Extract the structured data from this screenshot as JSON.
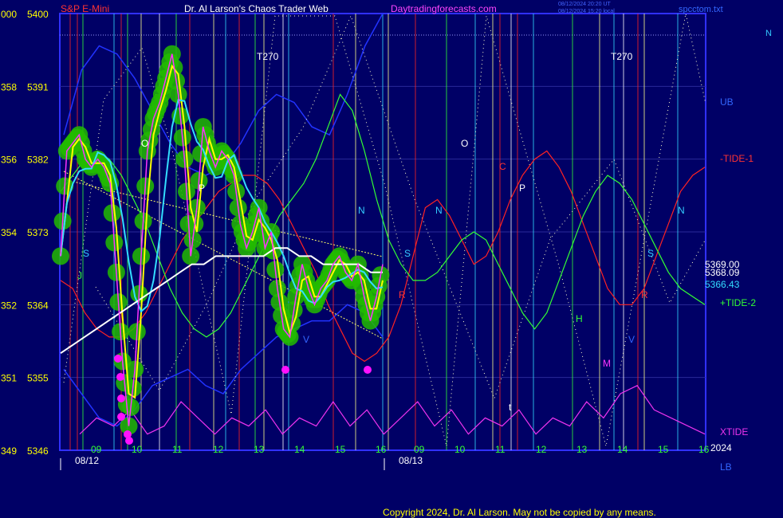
{
  "header": {
    "instrument": "S&P E-Mini",
    "title": "Dr. Al Larson's Chaos Trader Web",
    "site": "Daytradingforecasts.com",
    "stamp1": "08/12/2024 20:20 UT",
    "stamp2": "08/12/2024 15:20 local",
    "file": "spcctom.txt",
    "corner": "N"
  },
  "footer": {
    "copyright": "Copyright 2024, Dr. Al Larson. May not be copied by any means.",
    "year": "2024"
  },
  "chart_data": {
    "type": "line",
    "ylim": [
      5346,
      5400
    ],
    "y_ticks_price": [
      "5400",
      "5391",
      "5382",
      "5373",
      "5364",
      "5355",
      "5346"
    ],
    "y_ticks_left": [
      "000",
      "358",
      "356",
      "354",
      "352",
      "351",
      "349"
    ],
    "x_hours_day1": [
      "09",
      "10",
      "11",
      "12",
      "13",
      "14",
      "15",
      "16"
    ],
    "x_hours_day2": [
      "09",
      "10",
      "11",
      "12",
      "13",
      "14",
      "15",
      "16"
    ],
    "dates": [
      "08/12",
      "08/13"
    ],
    "price_labels": {
      "close": "5369.00",
      "mid": "5368.09",
      "avg": "5366.43"
    },
    "right_labels": {
      "ub": "UB",
      "tide1": "-TIDE-1",
      "tide2": "+TIDE-2",
      "xtide": "XTIDE",
      "lb": "LB"
    },
    "markers": {
      "t270": "T270",
      "n": "N",
      "s": "S",
      "o": "O",
      "p": "P",
      "c": "C",
      "h": "H",
      "m": "M",
      "t": "t",
      "v": "V",
      "j": "J",
      "r": "R"
    },
    "colors": {
      "background": "#000066",
      "frame": "#3030ff",
      "price": "#ff33ff",
      "price_band": "#22bb00",
      "fast_avg": "#ffff00",
      "mid_avg": "#33ddff",
      "slow_avg": "#ffffff",
      "tide1": "#ff2222",
      "tide2": "#33ff33",
      "xtide": "#ee33ee",
      "bands": "#2233ff",
      "dots": "#ffffcc"
    },
    "series": [
      {
        "name": "Price",
        "values": [
          5370,
          5383,
          5384,
          5385,
          5382,
          5381,
          5382,
          5381,
          5379,
          5368,
          5357,
          5349,
          5356,
          5370,
          5383,
          5387,
          5389,
          5392,
          5395,
          5390,
          5382,
          5370,
          5376,
          5386,
          5383,
          5381,
          5383,
          5382,
          5380,
          5374,
          5371,
          5373,
          5376,
          5371,
          5373,
          5366,
          5361,
          5360,
          5365,
          5369,
          5366,
          5364,
          5366,
          5367,
          5369,
          5370,
          5368,
          5367,
          5369,
          5365,
          5362,
          5365,
          5369
        ]
      },
      {
        "name": "-TIDE-1",
        "values": [
          5367,
          5366,
          5363,
          5361,
          5360,
          5360,
          5361,
          5363,
          5366,
          5369,
          5372,
          5374,
          5376,
          5378,
          5379,
          5380,
          5380,
          5379,
          5377,
          5374,
          5371,
          5368,
          5364,
          5361,
          5358,
          5357,
          5358,
          5360,
          5364,
          5370,
          5376,
          5377,
          5375,
          5372,
          5369,
          5370,
          5373,
          5377,
          5380,
          5382,
          5383,
          5381,
          5378,
          5374,
          5370,
          5366,
          5364,
          5364,
          5366,
          5370,
          5374,
          5378,
          5380,
          5381
        ]
      },
      {
        "name": "+TIDE-2",
        "values": [
          5378,
          5380,
          5382,
          5383,
          5382,
          5380,
          5377,
          5374,
          5370,
          5366,
          5363,
          5361,
          5360,
          5361,
          5363,
          5366,
          5369,
          5372,
          5375,
          5377,
          5379,
          5382,
          5386,
          5390,
          5388,
          5383,
          5377,
          5372,
          5369,
          5367,
          5367,
          5368,
          5370,
          5372,
          5373,
          5372,
          5369,
          5366,
          5363,
          5361,
          5363,
          5367,
          5371,
          5375,
          5378,
          5380,
          5379,
          5377,
          5374,
          5371,
          5368,
          5366,
          5365,
          5364
        ]
      },
      {
        "name": "XTIDE",
        "values": [
          5348,
          5350,
          5349,
          5351,
          5348,
          5349,
          5352,
          5350,
          5348,
          5350,
          5349,
          5351,
          5348,
          5350,
          5349,
          5352,
          5349,
          5351,
          5348,
          5350,
          5352,
          5349,
          5351,
          5348,
          5350,
          5349,
          5351,
          5348,
          5350,
          5349,
          5352,
          5350,
          5353,
          5354,
          5351,
          5350,
          5349,
          5348
        ]
      }
    ]
  }
}
